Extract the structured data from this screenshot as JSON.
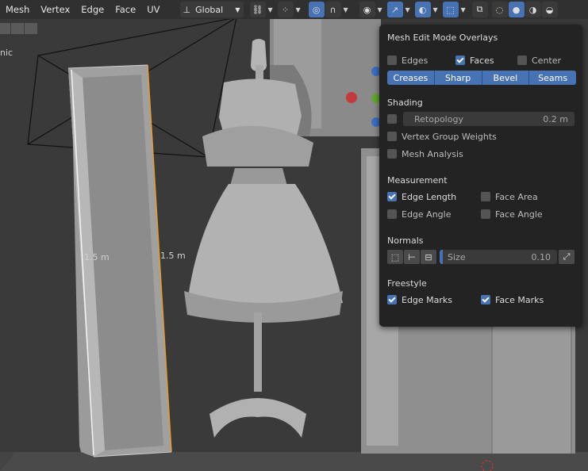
{
  "menu": [
    "Mesh",
    "Vertex",
    "Edge",
    "Face",
    "UV"
  ],
  "transform_orientation": "Global",
  "viewport": {
    "left_label": "nic",
    "measure_left": "1.5 m",
    "measure_right": "1.5 m",
    "wire_color": "#e8e8e8",
    "edge_highlight_color": "#e89a2c"
  },
  "panel": {
    "title": "Mesh Edit Mode Overlays",
    "toggles_top": [
      {
        "label": "Edges",
        "checked": false
      },
      {
        "label": "Faces",
        "checked": true
      },
      {
        "label": "Center",
        "checked": false
      }
    ],
    "edge_marks": [
      "Creases",
      "Sharp",
      "Bevel",
      "Seams"
    ],
    "shading": {
      "heading": "Shading",
      "retopology_label": "Retopology",
      "retopology_value": "0.2 m",
      "vertex_group_weights": "Vertex Group Weights",
      "mesh_analysis": "Mesh Analysis"
    },
    "measurement": {
      "heading": "Measurement",
      "edge_length": "Edge Length",
      "face_area": "Face Area",
      "edge_angle": "Edge Angle",
      "face_angle": "Face Angle"
    },
    "normals": {
      "heading": "Normals",
      "size_label": "Size",
      "size_value": "0.10"
    },
    "freestyle": {
      "heading": "Freestyle",
      "edge_marks": "Edge Marks",
      "face_marks": "Face Marks"
    }
  },
  "colors": {
    "accent": "#4772b3",
    "panel_bg": "#232323",
    "header_bg": "#303030"
  }
}
